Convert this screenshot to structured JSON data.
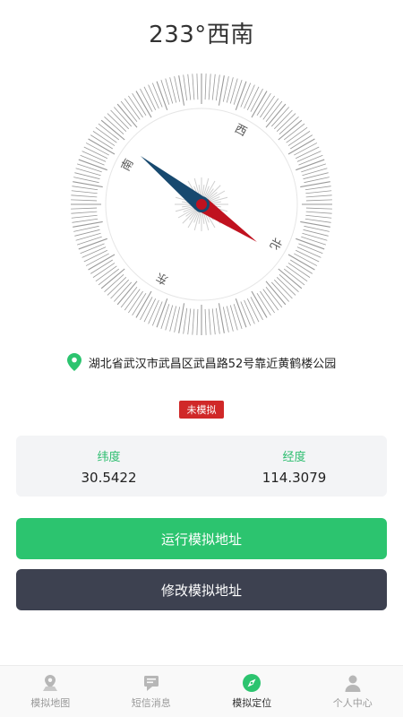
{
  "heading": {
    "degrees": "233°",
    "direction": "西南"
  },
  "compass": {
    "labels": {
      "north": "北",
      "east": "东",
      "south": "南",
      "west": "西"
    },
    "heading_deg": 233,
    "colors": {
      "needle_red": "#c0121f",
      "needle_blue": "#17496f",
      "tick": "#9a9a9a"
    }
  },
  "location": {
    "address": "湖北省武汉市武昌区武昌路52号靠近黄鹤楼公园"
  },
  "status": {
    "badge": "未模拟",
    "color": "#d02828"
  },
  "coords": {
    "lat_label": "纬度",
    "lat_value": "30.5422",
    "lng_label": "经度",
    "lng_value": "114.3079"
  },
  "buttons": {
    "run": "运行模拟地址",
    "edit": "修改模拟地址"
  },
  "tabs": [
    {
      "label": "模拟地图",
      "icon": "map-pin-icon"
    },
    {
      "label": "短信消息",
      "icon": "message-icon"
    },
    {
      "label": "模拟定位",
      "icon": "compass-icon",
      "active": true
    },
    {
      "label": "个人中心",
      "icon": "person-icon"
    }
  ],
  "theme": {
    "accent": "#2cc46f",
    "dark": "#3d4150"
  }
}
